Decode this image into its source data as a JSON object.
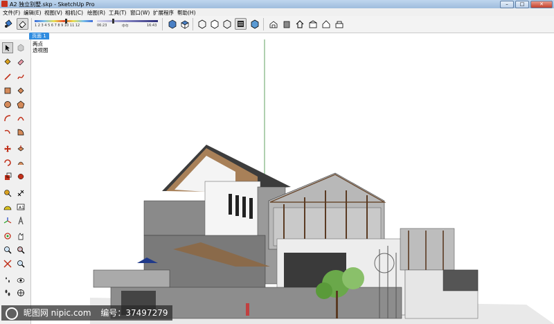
{
  "window": {
    "title": "A2 独立别墅.skp - SketchUp Pro",
    "minimize_label": "–",
    "maximize_label": "□",
    "close_label": "✕"
  },
  "menu": {
    "items": [
      "文件(F)",
      "编辑(E)",
      "视图(V)",
      "相机(C)",
      "绘图(R)",
      "工具(T)",
      "窗口(W)",
      "扩展程序",
      "帮助(H)"
    ]
  },
  "shadow": {
    "month_labels": "1 2 3 4 5 6 7 8 9 10 11 12",
    "time_start": "06:23",
    "time_mid": "中午",
    "time_end": "16:43"
  },
  "scene": {
    "tab_label": "页面 1"
  },
  "camera": {
    "line1": "两点",
    "line2": "透视图"
  },
  "watermark": {
    "text": "昵图网 nipic.com",
    "id_text": "编号：37497279"
  },
  "colors": {
    "titlebar": "#a9c4e2",
    "scene_tab": "#2f8ce0"
  }
}
